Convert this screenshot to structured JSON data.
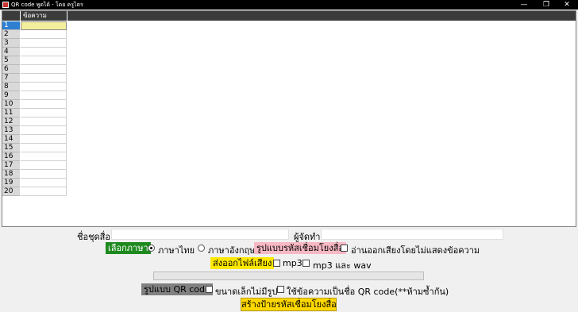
{
  "window": {
    "title": "QR code พูดได้ - โดย ครูไตร",
    "minimize": "—",
    "maximize": "❐",
    "close": "✕"
  },
  "grid": {
    "column_header": "ข้อความ",
    "rows": [
      "1",
      "2",
      "3",
      "4",
      "5",
      "6",
      "7",
      "8",
      "9",
      "10",
      "11",
      "12",
      "13",
      "14",
      "15",
      "16",
      "17",
      "18",
      "19",
      "20"
    ],
    "selected_row": "1"
  },
  "form": {
    "set_name_label": "ชื่อชุดสื่อ",
    "set_name_value": "",
    "creator_label": "ผู้จัดทำ",
    "creator_value": "",
    "language_label": "เลือกภาษา",
    "language_options": [
      "ภาษาไทย",
      "ภาษาอังกฤษ"
    ],
    "language_selected": "ภาษาไทย",
    "link_format_label": "รูปแบบรหัสเชื่อมโยงสื่อ",
    "read_no_text_label": "อ่านออกเสียงโดยไม่แสดงข้อความ",
    "export_audio_label": "ส่งออกไฟล์เสียง",
    "mp3_label": "mp3",
    "mp3_wav_label": "mp3 และ wav",
    "qr_format_label": "รูปแบบ QR code",
    "small_no_image_label": "ขนาดเล็กไม่มีรูป",
    "text_as_name_label": "ใช้ข้อความเป็นชื่อ QR code(**ห้ามซ้ำกัน)",
    "create_button": "สร้างป้ายรหัสเชื่อมโยงสื่อ"
  },
  "colors": {
    "language_tag": "#1e8a1e",
    "link_format_tag": "#f7b8c4",
    "export_tag": "#ffe800",
    "qr_format_tag": "#808080",
    "create_button": "#ffd800"
  }
}
